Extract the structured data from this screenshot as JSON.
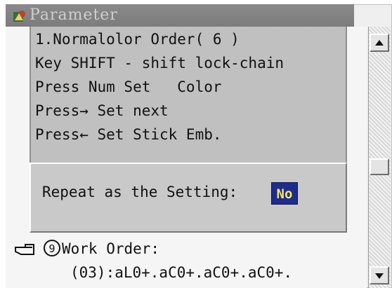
{
  "window": {
    "title": "Parameter",
    "icon": "app-icon"
  },
  "menu": {
    "lines": [
      "1.Normalolor Order( 6 )",
      "Key SHIFT - shift lock-chain",
      "Press Num Set   Color",
      "Press→ Set next",
      "Press← Set Stick Emb."
    ]
  },
  "dialog": {
    "label": "Repeat as the Setting:",
    "value": "No",
    "value_bg": "#1f2c8a",
    "value_fg": "#f5e56a"
  },
  "work_order": {
    "icon": "pointing-hand-icon",
    "number": "9",
    "label": "Work Order:",
    "value": "(03):aL0+.aC0+.aC0+.aC0+."
  },
  "scrollbar": {
    "up_icon": "arrow-up-icon",
    "down_icon": "arrow-down-icon"
  }
}
